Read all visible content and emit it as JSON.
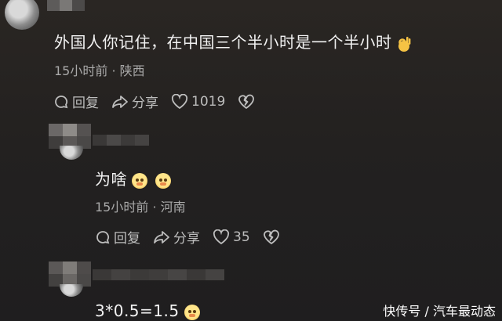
{
  "comments": [
    {
      "text": "外国人你记住，在中国三个半小时是一个半小时",
      "time": "15小时前",
      "location": "陕西",
      "reply_label": "回复",
      "share_label": "分享",
      "likes": "1019"
    },
    {
      "text": "为啥",
      "time": "15小时前",
      "location": "河南",
      "reply_label": "回复",
      "share_label": "分享",
      "likes": "35"
    },
    {
      "text": "3*0.5=1.5"
    }
  ],
  "meta_separator": "·",
  "watermark": "快传号 / 汽车最动态",
  "colors": {
    "background": "#242120",
    "text": "#f2f2f2",
    "meta": "#a9a9a9"
  }
}
